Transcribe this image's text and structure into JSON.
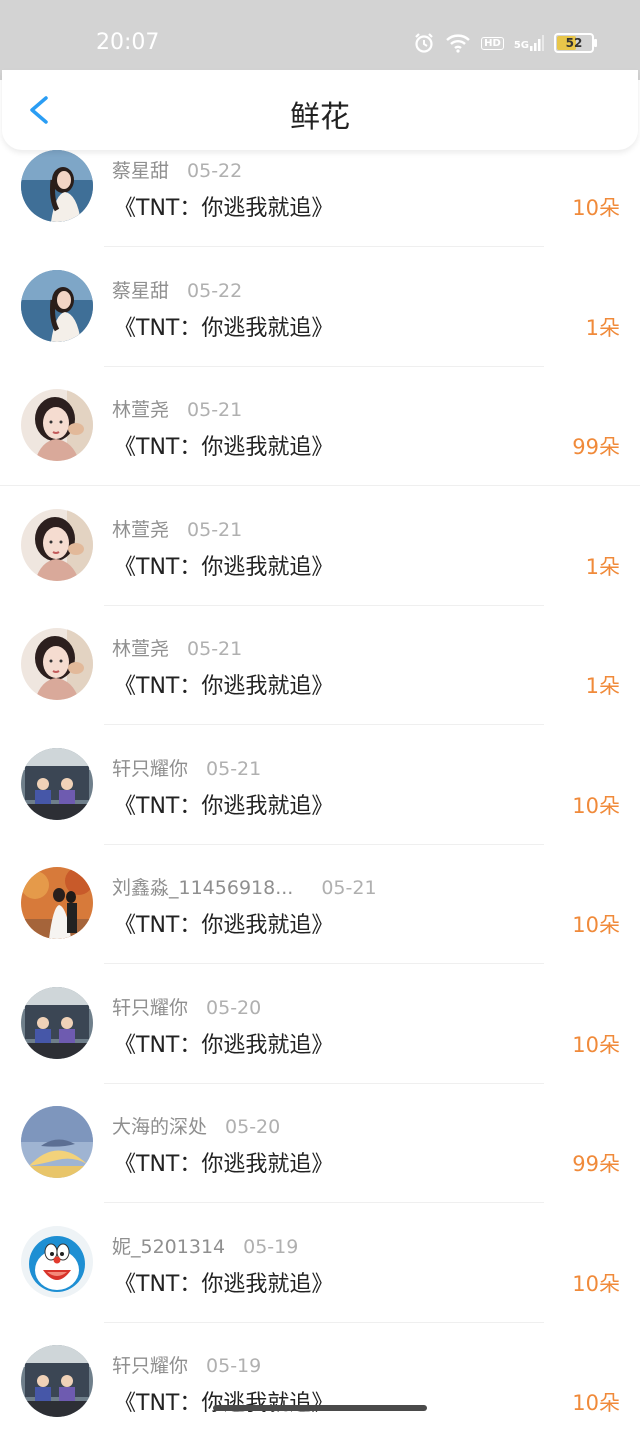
{
  "status_bar": {
    "time": "20:07",
    "network_label": "5G",
    "hd_label": "HD",
    "battery": "52"
  },
  "nav": {
    "title": "鲜花"
  },
  "items": [
    {
      "name": "蔡星甜",
      "date": "05-22",
      "title": "《TNT：你逃我就追》",
      "amount": "10朵",
      "avatar": "photo-sea-girl"
    },
    {
      "name": "蔡星甜",
      "date": "05-22",
      "title": "《TNT：你逃我就追》",
      "amount": "1朵",
      "avatar": "photo-sea-girl"
    },
    {
      "name": "林萱尧",
      "date": "05-21",
      "title": "《TNT：你逃我就追》",
      "amount": "99朵",
      "avatar": "photo-girl-portrait"
    },
    {
      "name": "林萱尧",
      "date": "05-21",
      "title": "《TNT：你逃我就追》",
      "amount": "1朵",
      "avatar": "photo-girl-portrait"
    },
    {
      "name": "林萱尧",
      "date": "05-21",
      "title": "《TNT：你逃我就追》",
      "amount": "1朵",
      "avatar": "photo-girl-portrait"
    },
    {
      "name": "轩只耀你",
      "date": "05-21",
      "title": "《TNT：你逃我就追》",
      "amount": "10朵",
      "avatar": "photo-group-car"
    },
    {
      "name": "刘鑫淼_11456918...",
      "date": "05-21",
      "title": "《TNT：你逃我就追》",
      "amount": "10朵",
      "avatar": "photo-autumn-couple"
    },
    {
      "name": "轩只耀你",
      "date": "05-20",
      "title": "《TNT：你逃我就追》",
      "amount": "10朵",
      "avatar": "photo-group-car"
    },
    {
      "name": "大海的深处",
      "date": "05-20",
      "title": "《TNT：你逃我就追》",
      "amount": "99朵",
      "avatar": "photo-moon-whale"
    },
    {
      "name": "妮_5201314",
      "date": "05-19",
      "title": "《TNT：你逃我就追》",
      "amount": "10朵",
      "avatar": "doraemon-cartoon"
    },
    {
      "name": "轩只耀你",
      "date": "05-19",
      "title": "《TNT：你逃我就追》",
      "amount": "10朵",
      "avatar": "photo-group-car"
    }
  ],
  "colors": {
    "amount": "#f08a3a",
    "back_icon": "#2a9df4",
    "status_bar_bg": "#d3d3d3"
  }
}
